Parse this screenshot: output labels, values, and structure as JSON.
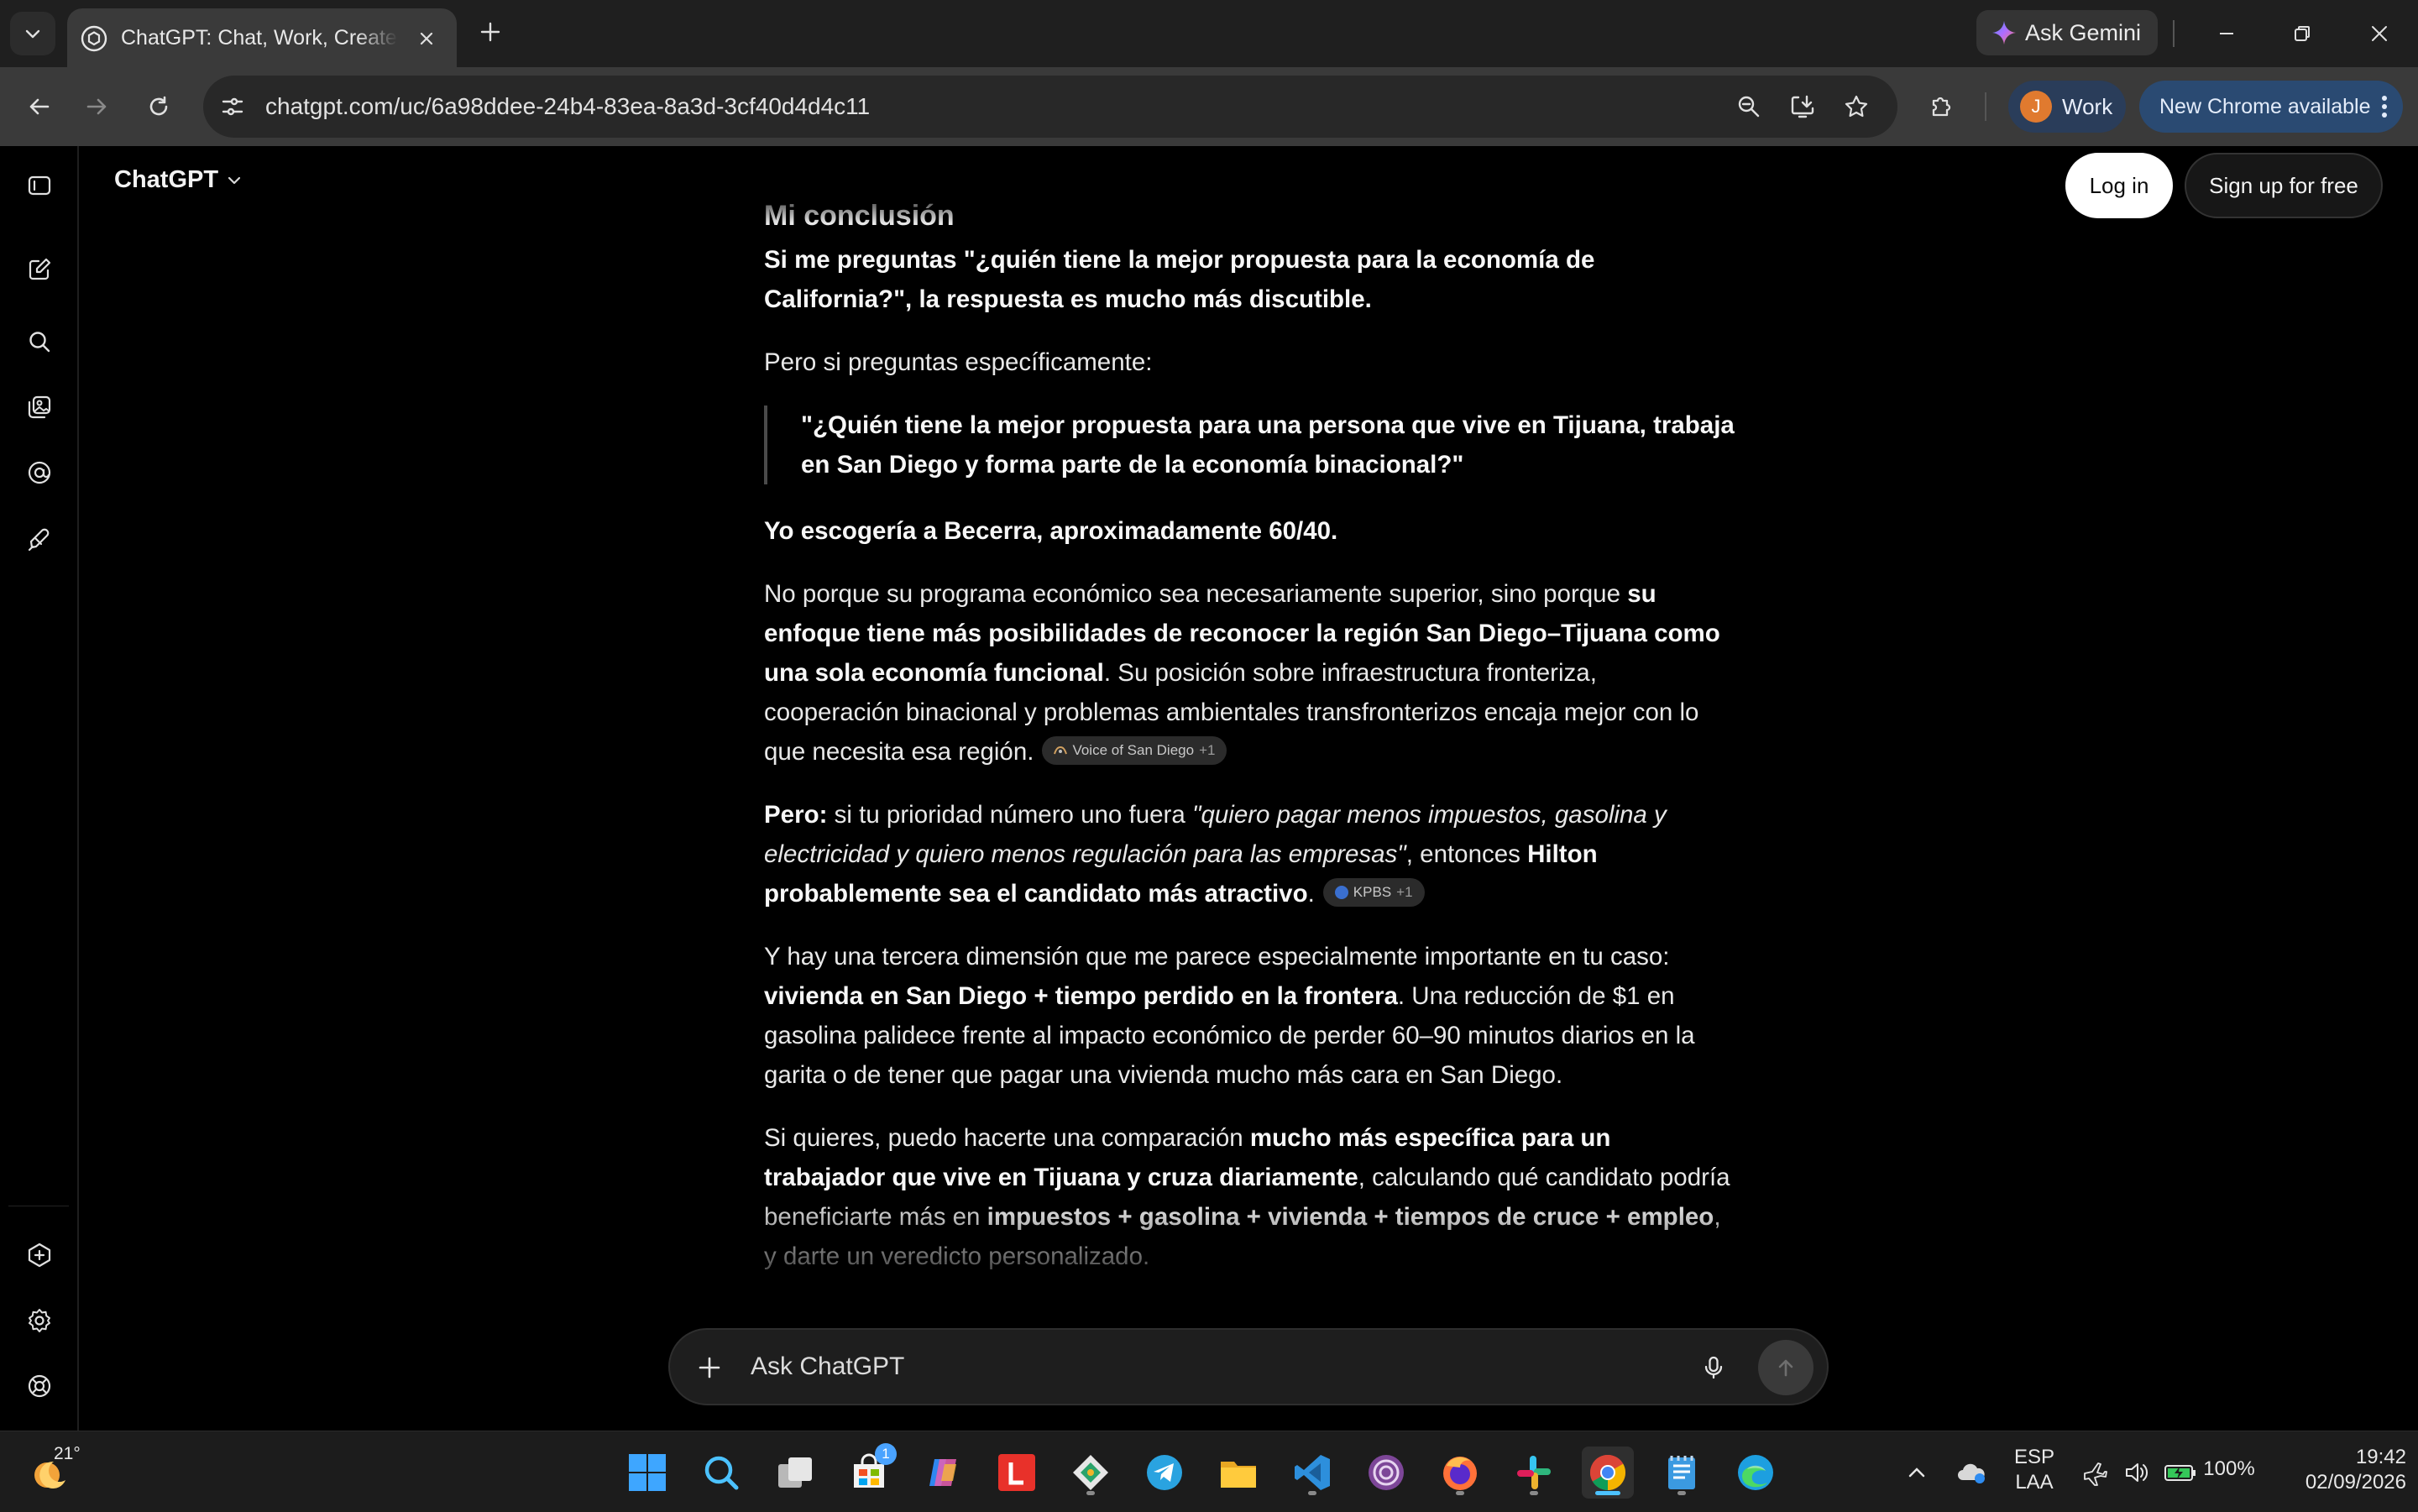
{
  "browser": {
    "tab_title": "ChatGPT: Chat, Work, Create & Build",
    "ask_gemini": "Ask Gemini",
    "url": "chatgpt.com/uc/6a98ddee-24b4-83ea-8a3d-3cf40d4d4c11",
    "profile_initial": "J",
    "profile_name": "Work",
    "update_label": "New Chrome available"
  },
  "app": {
    "brand": "ChatGPT",
    "login_label": "Log in",
    "signup_label": "Sign up for free"
  },
  "message": {
    "heading": "Mi conclusión",
    "p1": "Si me preguntas \"¿quién tiene la mejor propuesta para la economía de California?\", la respuesta es mucho más discutible.",
    "p2": "Pero si preguntas específicamente:",
    "quote": "\"¿Quién tiene la mejor propuesta para una persona que vive en Tijuana, trabaja en San Diego y forma parte de la economía binacional?\"",
    "p3": "Yo escogería a Becerra, aproximadamente 60/40.",
    "p4_a": "No porque su programa económico sea necesariamente superior, sino porque ",
    "p4_b": "su enfoque tiene más posibilidades de reconocer la región San Diego–Tijuana como una sola economía funcional",
    "p4_c": ". Su posición sobre infraestructura fronteriza, cooperación binacional y problemas ambientales transfronterizos encaja mejor con lo que necesita esa región.",
    "citation1_source": "Voice of San Diego",
    "citation1_more": "+1",
    "p5_a": "Pero:",
    "p5_b": " si tu prioridad número uno fuera ",
    "p5_c": "\"quiero pagar menos impuestos, gasolina y electricidad y quiero menos regulación para las empresas\"",
    "p5_d": ", entonces ",
    "p5_e": "Hilton probablemente sea el candidato más atractivo",
    "p5_f": ".",
    "citation2_source": "KPBS",
    "citation2_more": "+1",
    "p6_a": "Y hay una tercera dimensión que me parece especialmente importante en tu caso: ",
    "p6_b": "vivienda en San Diego + tiempo perdido en la frontera",
    "p6_c": ". Una reducción de $1 en gasolina palidece frente al impacto económico de perder 60–90 minutos diarios en la garita o de tener que pagar una vivienda mucho más cara en San Diego.",
    "p7_a": "Si quieres, puedo hacerte una comparación ",
    "p7_b": "mucho más específica para un trabajador que vive en Tijuana y cruza diariamente",
    "p7_c": ", calculando qué candidato podría beneficiarte más en ",
    "p7_d": "impuestos + gasolina + vivienda + tiempos de cruce + empleo",
    "p7_e": ", y darte un veredicto personalizado."
  },
  "composer": {
    "placeholder": "Ask ChatGPT"
  },
  "taskbar": {
    "weather_temp": "21°",
    "store_badge": "1",
    "lang_top": "ESP",
    "lang_bottom": "LAA",
    "battery": "100%",
    "time": "19:42",
    "date": "02/09/2026"
  },
  "colors": {
    "chrome_tabstrip": "#1f1f1f",
    "chrome_toolbar": "#3a3a3a",
    "page_background": "#000000",
    "profile_pill": "#2a3d5a",
    "update_pill": "#2a4a72",
    "taskbar": "#1c1c1c"
  },
  "icons": [
    "tab-search-icon",
    "chatgpt-favicon",
    "close-icon",
    "plus-icon",
    "gemini-icon",
    "minimize-icon",
    "restore-icon",
    "back-icon",
    "forward-icon",
    "reload-icon",
    "site-info-icon",
    "zoom-icon",
    "install-icon",
    "star-icon",
    "extensions-icon",
    "sidebar-toggle-icon",
    "new-chat-icon",
    "search-icon",
    "images-icon",
    "apps-icon",
    "codex-icon",
    "upgrade-icon",
    "settings-icon",
    "help-icon",
    "mic-icon",
    "send-arrow-icon",
    "windows-start-icon",
    "weather-icon"
  ]
}
